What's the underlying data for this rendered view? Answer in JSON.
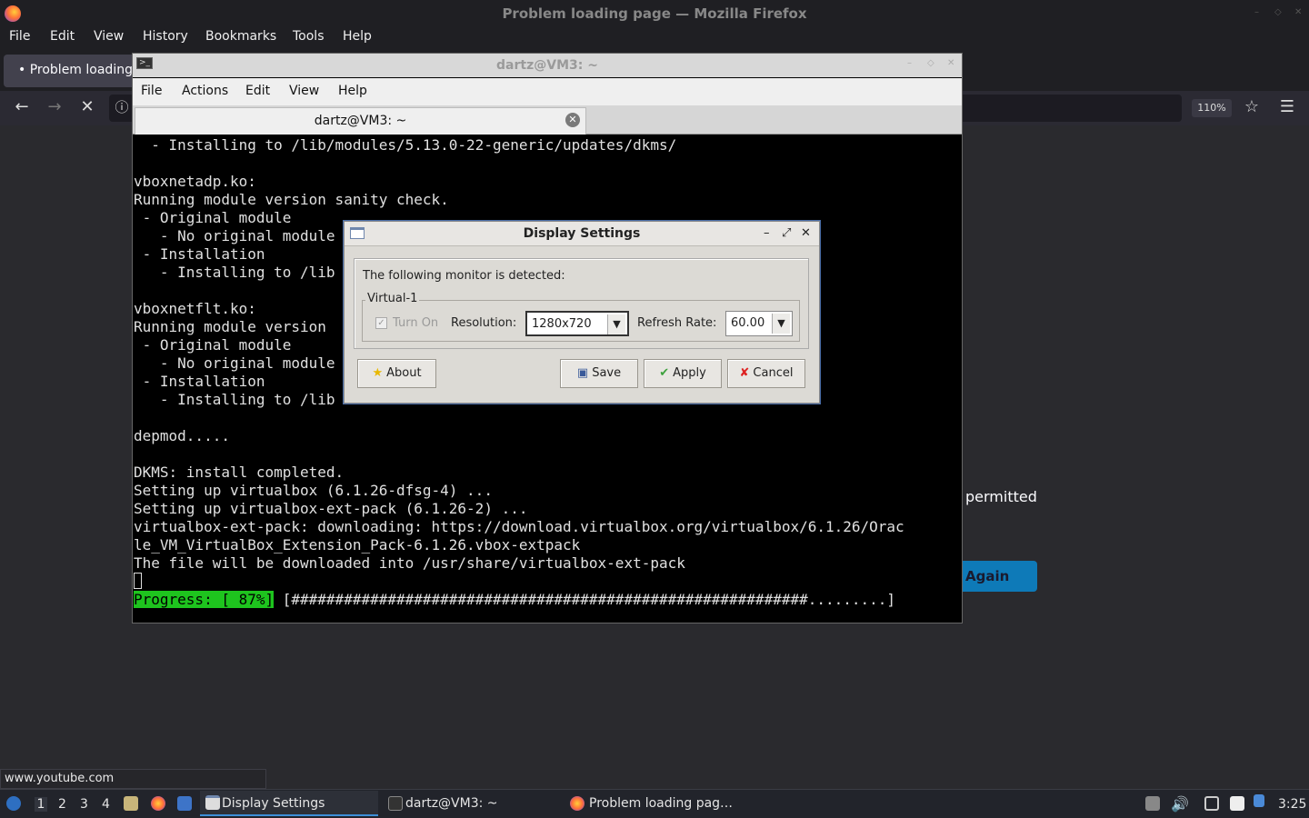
{
  "firefox": {
    "window_title": "Problem loading page — Mozilla Firefox",
    "menu": [
      "File",
      "Edit",
      "View",
      "History",
      "Bookmarks",
      "Tools",
      "Help"
    ],
    "tab_label": "• Problem loading",
    "zoom": "110%",
    "error_fragment": "permitted",
    "try_again_fragment": "Again",
    "status_url": "www.youtube.com"
  },
  "terminal": {
    "window_title": "dartz@VM3: ~",
    "menu": [
      "File",
      "Actions",
      "Edit",
      "View",
      "Help"
    ],
    "tab_title": "dartz@VM3: ~",
    "lines": [
      "  - Installing to /lib/modules/5.13.0-22-generic/updates/dkms/",
      "",
      "vboxnetadp.ko:",
      "Running module version sanity check.",
      " - Original module",
      "   - No original module",
      " - Installation",
      "   - Installing to /lib",
      "",
      "vboxnetflt.ko:",
      "Running module version",
      " - Original module",
      "   - No original module",
      " - Installation",
      "   - Installing to /lib",
      "",
      "depmod.....",
      "",
      "DKMS: install completed.",
      "Setting up virtualbox (6.1.26-dfsg-4) ...",
      "Setting up virtualbox-ext-pack (6.1.26-2) ...",
      "virtualbox-ext-pack: downloading: https://download.virtualbox.org/virtualbox/6.1.26/Orac",
      "le_VM_VirtualBox_Extension_Pack-6.1.26.vbox-extpack",
      "The file will be downloaded into /usr/share/virtualbox-ext-pack"
    ],
    "progress_label": "Progress: [ 87%]",
    "progress_bar": " [###########################################################.........]",
    "progress_value": 0.87
  },
  "dialog": {
    "title": "Display Settings",
    "detected_text": "The following monitor is detected:",
    "monitor_name": "Virtual-1",
    "turn_on_label": "Turn On",
    "turn_on_checked": true,
    "resolution_label": "Resolution:",
    "resolution_value": "1280x720",
    "refresh_label": "Refresh Rate:",
    "refresh_value": "60.00",
    "about_label": "About",
    "save_label": "Save",
    "apply_label": "Apply",
    "cancel_label": "Cancel"
  },
  "taskbar": {
    "workspaces": [
      "1",
      "2",
      "3",
      "4"
    ],
    "tasks": [
      "Display Settings",
      "dartz@VM3: ~",
      "Problem loading pag…"
    ],
    "clock": "3:25"
  }
}
